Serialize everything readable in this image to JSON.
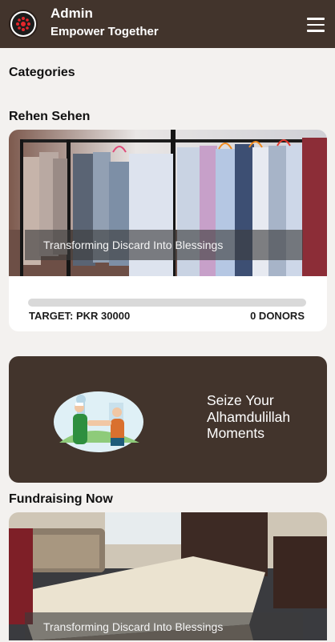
{
  "header": {
    "title": "Admin",
    "subtitle": "Empower Together"
  },
  "categories": {
    "heading": "Categories"
  },
  "campaign": {
    "name": "Rehen Sehen",
    "caption": "Transforming Discard Into Blessings",
    "target_label": "TARGET: PKR 30000",
    "donors_label": "0 DONORS",
    "progress_fraction": 0
  },
  "promo": {
    "line1": "Seize Your",
    "line2": "Alhamdulillah",
    "line3": "Moments"
  },
  "fundraising": {
    "heading": "Fundraising Now",
    "caption": "Transforming Discard Into Blessings"
  },
  "colors": {
    "brand_brown": "#42342c",
    "page_bg": "#f3f1ef",
    "logo_red": "#e3262b"
  },
  "icons": {
    "logo": "dots-circle-logo-icon",
    "menu": "hamburger-menu-icon"
  }
}
